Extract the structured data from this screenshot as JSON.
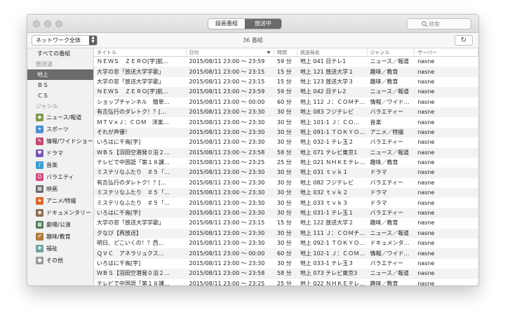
{
  "segments": [
    "録画番組",
    "放送中"
  ],
  "search_placeholder": "検索",
  "network_select": "ネットワーク全体",
  "program_count": "36 番組",
  "sidebar": {
    "all_programs": "すべての番組",
    "wave_header": "放送波",
    "waves": [
      "地上",
      "ＢＳ",
      "ＣＳ"
    ],
    "genre_header": "ジャンル",
    "genres": [
      {
        "label": "ニュース/報道",
        "icon": "news-icon",
        "color": "#7f9a4a",
        "glyph": "◆"
      },
      {
        "label": "スポーツ",
        "icon": "sports-icon",
        "color": "#4a8fd0",
        "glyph": "✦"
      },
      {
        "label": "情報/ワイドショー",
        "icon": "info-icon",
        "color": "#c4486e",
        "glyph": "✎"
      },
      {
        "label": "ドラマ",
        "icon": "drama-icon",
        "color": "#7a55b8",
        "glyph": "♥"
      },
      {
        "label": "音楽",
        "icon": "music-icon",
        "color": "#3a9fd2",
        "glyph": "♪"
      },
      {
        "label": "バラエティ",
        "icon": "variety-icon",
        "color": "#d2457d",
        "glyph": "☺"
      },
      {
        "label": "映画",
        "icon": "movie-icon",
        "color": "#6a6a6a",
        "glyph": "▦"
      },
      {
        "label": "アニメ/特撮",
        "icon": "anime-icon",
        "color": "#d96a2e",
        "glyph": "★"
      },
      {
        "label": "ドキュメンタリー",
        "icon": "documentary-icon",
        "color": "#8a6d4e",
        "glyph": "◉"
      },
      {
        "label": "劇場/公演",
        "icon": "theater-icon",
        "color": "#4f7a55",
        "glyph": "▩"
      },
      {
        "label": "趣味/教育",
        "icon": "hobby-icon",
        "color": "#b07a38",
        "glyph": "✐"
      },
      {
        "label": "福祉",
        "icon": "welfare-icon",
        "color": "#6fa5a0",
        "glyph": "✚"
      },
      {
        "label": "その他",
        "icon": "other-icon",
        "color": "#9a9a9a",
        "glyph": "●"
      }
    ]
  },
  "columns": [
    "タイトル",
    "日付",
    "時間",
    "放送局名",
    "ジャンル",
    "サーバー"
  ],
  "rows": [
    [
      "ＮＥＷＳ　ＺＥＲＯ[字]航…",
      "2015/08/11 23:00 〜 23:59",
      "59 分",
      "地上 041 日テレ1",
      "ニュース／報道",
      "nasne"
    ],
    [
      "大学の窓「放送大学学歌」",
      "2015/08/11 23:00 〜 23:15",
      "15 分",
      "地上 121 放送大学１",
      "趣味／教育",
      "nasne"
    ],
    [
      "大学の窓「放送大学学歌」",
      "2015/08/11 23:00 〜 23:15",
      "15 分",
      "地上 123 放送大学３",
      "趣味／教育",
      "nasne"
    ],
    [
      "ＮＥＷＳ　ＺＥＲＯ[字]航…",
      "2015/08/11 23:00 〜 23:59",
      "59 分",
      "地上 042 日テレ2",
      "ニュース／報道",
      "nasne"
    ],
    [
      "ショップチャンネル　簡単…",
      "2015/08/11 23:00 〜 00:00",
      "60 分",
      "地上 112 Ｊ：ＣＯＭチ…",
      "情報／ワイド…",
      "nasne"
    ],
    [
      "有吉弘行のダレトク！？[…",
      "2015/08/11 23:00 〜 23:30",
      "30 分",
      "地上 083 フジテレビ",
      "バラエティー",
      "nasne"
    ],
    [
      "ＭＴＶ×Ｊ：ＣＯＭ　洋楽…",
      "2015/08/11 23:00 〜 23:30",
      "30 分",
      "地上 101-1 Ｊ：ＣＯ…",
      "音楽",
      "nasne"
    ],
    [
      "それが声優！",
      "2015/08/11 23:00 〜 23:30",
      "30 分",
      "地上 091-1 ＴＯＫＹＯ…",
      "アニメ／特撮",
      "nasne"
    ],
    [
      "いろはに千鳥[字]",
      "2015/08/11 23:00 〜 23:30",
      "30 分",
      "地上 032-1 テレ玉２",
      "バラエティー",
      "nasne"
    ],
    [
      "ＷＢＳ【羽田空港発０泊２…",
      "2015/08/11 23:00 〜 23:58",
      "58 分",
      "地上 071 テレビ東京1",
      "ニュース／報道",
      "nasne"
    ],
    [
      "テレビで中国語「第１８課…",
      "2015/08/11 23:00 〜 23:25",
      "25 分",
      "地上 021 ＮＨＫＥテレ…",
      "趣味／教育",
      "nasne"
    ],
    [
      "ミステリなふたり　＃５「…",
      "2015/08/11 23:00 〜 23:30",
      "30 分",
      "地上 031 ｔｖｋ１",
      "ドラマ",
      "nasne"
    ],
    [
      "有吉弘行のダレトク！？[…",
      "2015/08/11 23:00 〜 23:30",
      "30 分",
      "地上 082 フジテレビ",
      "バラエティー",
      "nasne"
    ],
    [
      "ミステリなふたり　＃５「…",
      "2015/08/11 23:00 〜 23:30",
      "30 分",
      "地上 032 ｔｖｋ２",
      "ドラマ",
      "nasne"
    ],
    [
      "ミステリなふたり　＃５「…",
      "2015/08/11 23:00 〜 23:30",
      "30 分",
      "地上 033 ｔｖｋ３",
      "ドラマ",
      "nasne"
    ],
    [
      "いろはに千鳥[字]",
      "2015/08/11 23:00 〜 23:30",
      "30 分",
      "地上 031-1 テレ玉１",
      "バラエティー",
      "nasne"
    ],
    [
      "大学の窓「放送大学学歌」",
      "2015/08/11 23:00 〜 23:15",
      "15 分",
      "地上 122 放送大学２",
      "趣味／教育",
      "nasne"
    ],
    [
      "夕なび【再放送】",
      "2015/08/11 23:00 〜 23:30",
      "30 分",
      "地上 111 Ｊ：ＣＯＭチ…",
      "ニュース／報道",
      "nasne"
    ],
    [
      "明日、どこいくの！？西…",
      "2015/08/11 23:00 〜 23:30",
      "30 分",
      "地上 092-1 ＴＯＫＹＯ…",
      "ドキュメンタ…",
      "nasne"
    ],
    [
      "ＱＶＣ　アネラリュクス…",
      "2015/08/11 23:00 〜 00:00",
      "60 分",
      "地上 102-1 Ｊ：ＣＯＭ…",
      "情報／ワイド…",
      "nasne"
    ],
    [
      "いろはに千鳥[字]",
      "2015/08/11 23:00 〜 23:30",
      "30 分",
      "地上 033-1 テレ玉３",
      "バラエティー",
      "nasne"
    ],
    [
      "ＷＢＳ【羽田空港発０泊２…",
      "2015/08/11 23:00 〜 23:58",
      "58 分",
      "地上 073 テレビ東京3",
      "ニュース／報道",
      "nasne"
    ],
    [
      "テレビで中国語「第１８課…",
      "2015/08/11 23:00 〜 23:25",
      "25 分",
      "地上 022 ＮＨＫＥテレ…",
      "趣味／教育",
      "nasne"
    ]
  ]
}
